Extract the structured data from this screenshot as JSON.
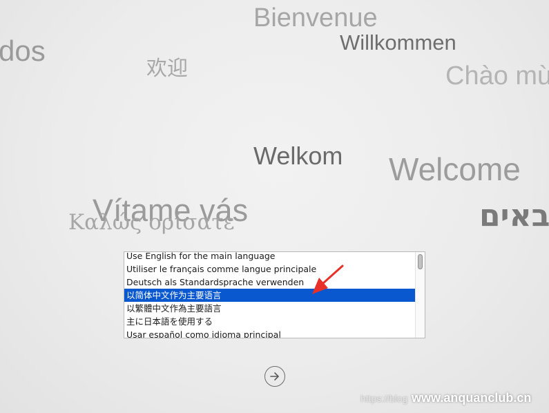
{
  "greetings": {
    "dos": "dos",
    "bienvenue": "Bienvenue",
    "willkommen": "Willkommen",
    "huanying": "欢迎",
    "chao": "Chào mừ",
    "welkom": "Welkom",
    "welcome": "Welcome",
    "vitame": "Vítame vás",
    "kalos": "Καλώς ορίσατε",
    "hebrew": "באים"
  },
  "language_list": {
    "options": [
      "Use English for the main language",
      "Utiliser le français comme langue principale",
      "Deutsch als Standardsprache verwenden",
      "以简体中文作为主要语言",
      "以繁體中文作為主要語言",
      "主に日本語を使用する",
      "Usar español como idioma principal"
    ],
    "selected_index": 3,
    "selected_color": "#0a58d0"
  },
  "continue_button": {
    "icon": "arrow-right-circle-icon"
  },
  "annotation": {
    "arrow_color": "#e8302a"
  },
  "watermark": {
    "url": "https://blog",
    "site": "www.anquanclub.cn"
  }
}
